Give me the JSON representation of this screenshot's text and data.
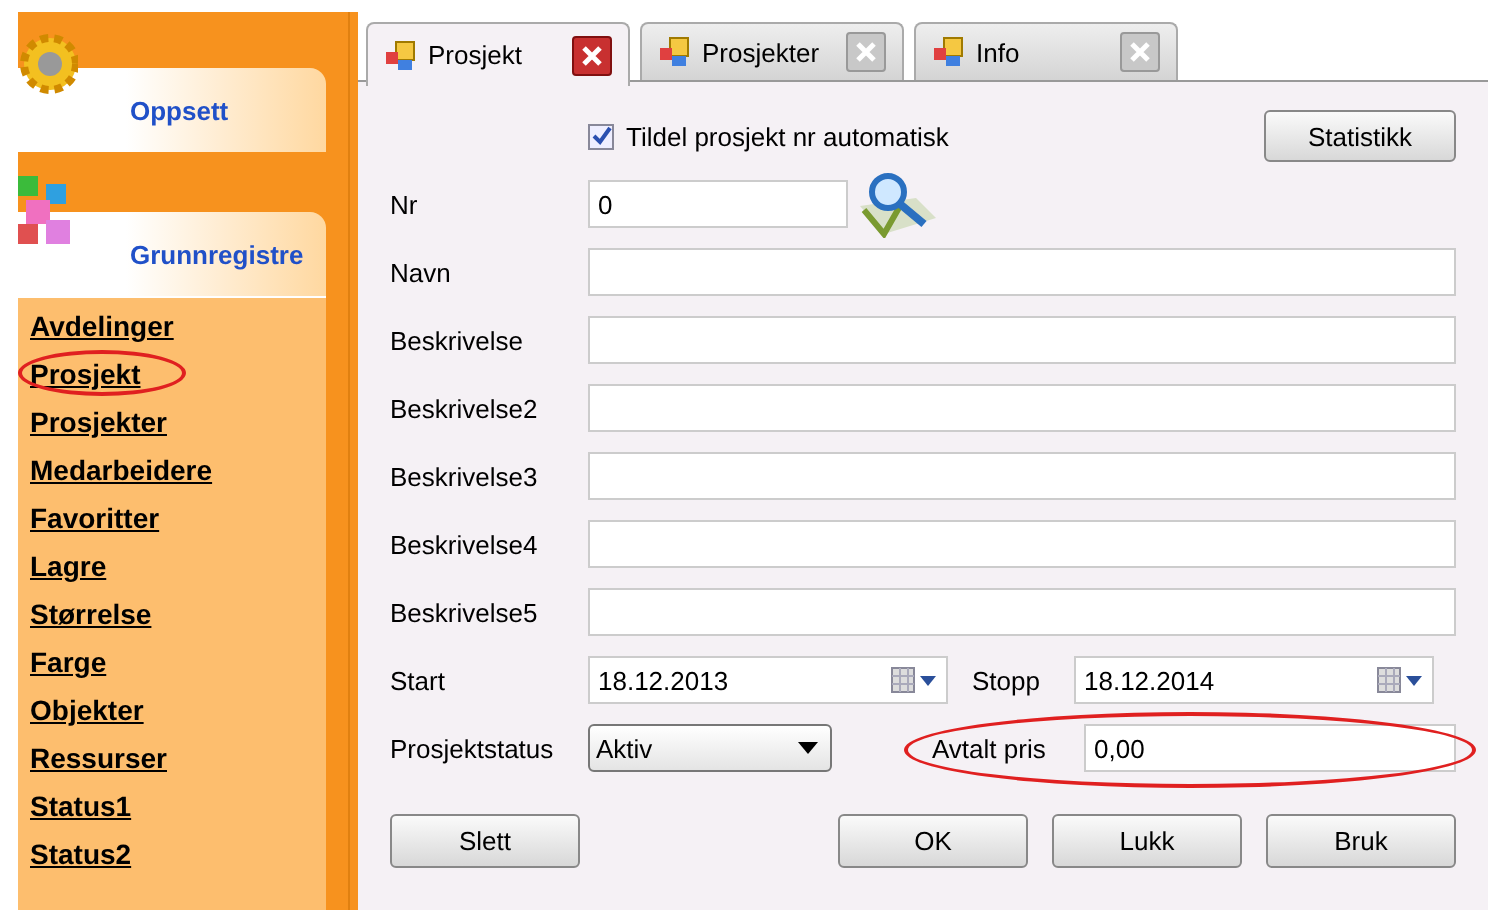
{
  "sidebar": {
    "sections": [
      {
        "title": "Oppsett",
        "kind": "gear"
      },
      {
        "title": "Grunnregistre",
        "kind": "blocks"
      }
    ],
    "items": [
      {
        "label": "Avdelinger",
        "circled": false
      },
      {
        "label": "Prosjekt",
        "circled": true
      },
      {
        "label": "Prosjekter",
        "circled": false
      },
      {
        "label": "Medarbeidere",
        "circled": false
      },
      {
        "label": "Favoritter",
        "circled": false
      },
      {
        "label": "Lagre",
        "circled": false
      },
      {
        "label": "Størrelse",
        "circled": false
      },
      {
        "label": "Farge",
        "circled": false
      },
      {
        "label": "Objekter",
        "circled": false
      },
      {
        "label": "Ressurser",
        "circled": false
      },
      {
        "label": "Status1",
        "circled": false
      },
      {
        "label": "Status2",
        "circled": false
      }
    ]
  },
  "tabs": [
    {
      "label": "Prosjekt",
      "selected": true
    },
    {
      "label": "Prosjekter",
      "selected": false
    },
    {
      "label": "Info",
      "selected": false
    }
  ],
  "form": {
    "auto_number": {
      "label": "Tildel prosjekt nr automatisk",
      "checked": true
    },
    "statistics_button": "Statistikk",
    "nr": {
      "label": "Nr",
      "value": "0"
    },
    "text_fields": [
      {
        "label": "Navn"
      },
      {
        "label": "Beskrivelse"
      },
      {
        "label": "Beskrivelse2"
      },
      {
        "label": "Beskrivelse3"
      },
      {
        "label": "Beskrivelse4"
      },
      {
        "label": "Beskrivelse5"
      }
    ],
    "start": {
      "label": "Start",
      "value": "18.12.2013"
    },
    "stop": {
      "label": "Stopp",
      "value": "18.12.2014"
    },
    "status": {
      "label": "Prosjektstatus",
      "value": "Aktiv"
    },
    "price": {
      "label": "Avtalt pris",
      "value": "0,00",
      "circled": true
    }
  },
  "buttons": [
    {
      "label": "Slett"
    },
    {
      "label": "OK"
    },
    {
      "label": "Lukk"
    },
    {
      "label": "Bruk"
    }
  ]
}
